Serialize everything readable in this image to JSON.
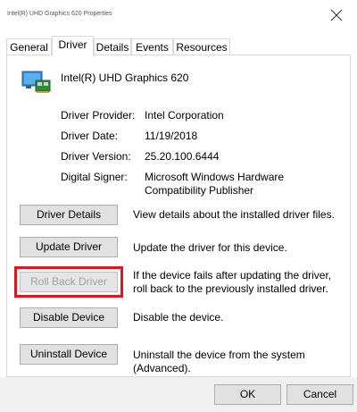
{
  "window": {
    "title": "Intel(R) UHD Graphics 620 Properties"
  },
  "tabs": [
    {
      "label": "General"
    },
    {
      "label": "Driver"
    },
    {
      "label": "Details"
    },
    {
      "label": "Events"
    },
    {
      "label": "Resources"
    }
  ],
  "device": {
    "name": "Intel(R) UHD Graphics 620",
    "icon": "display-adapter-icon"
  },
  "info": [
    {
      "label": "Driver Provider:",
      "value": "Intel Corporation"
    },
    {
      "label": "Driver Date:",
      "value": "11/19/2018"
    },
    {
      "label": "Driver Version:",
      "value": "25.20.100.6444"
    },
    {
      "label": "Digital Signer:",
      "value": "Microsoft Windows Hardware Compatibility Publisher"
    }
  ],
  "actions": [
    {
      "label": "Driver Details",
      "description": "View details about the installed driver files.",
      "enabled": true
    },
    {
      "label": "Update Driver",
      "description": "Update the driver for this device.",
      "enabled": true
    },
    {
      "label": "Roll Back Driver",
      "description": "If the device fails after updating the driver, roll back to the previously installed driver.",
      "enabled": false,
      "highlighted": true
    },
    {
      "label": "Disable Device",
      "description": "Disable the device.",
      "enabled": true
    },
    {
      "label": "Uninstall Device",
      "description": "Uninstall the device from the system (Advanced).",
      "enabled": true
    }
  ],
  "dialog_buttons": {
    "ok": "OK",
    "cancel": "Cancel"
  },
  "colors": {
    "highlight": "#e0161c",
    "button_face": "#e1e1e1",
    "disabled_text": "#a0a0a0"
  }
}
